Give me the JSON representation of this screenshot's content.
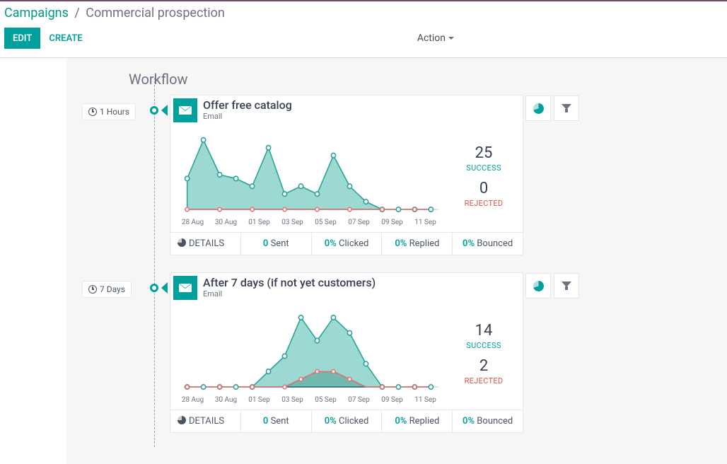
{
  "breadcrumb": {
    "root": "Campaigns",
    "current": "Commercial prospection"
  },
  "toolbar": {
    "edit": "EDIT",
    "create": "CREATE",
    "action": "Action"
  },
  "workflow": {
    "title": "Workflow"
  },
  "activities": [
    {
      "delay": "1 Hours",
      "title": "Offer free catalog",
      "type": "Email",
      "success": 25,
      "success_label": "SUCCESS",
      "rejected": 0,
      "rejected_label": "REJECTED"
    },
    {
      "delay": "7 Days",
      "title": "After 7 days (if not yet customers)",
      "type": "Email",
      "success": 14,
      "success_label": "SUCCESS",
      "rejected": 2,
      "rejected_label": "REJECTED"
    }
  ],
  "footer": {
    "details": "DETAILS",
    "sent_val": "0",
    "sent_lbl": " Sent",
    "clicked_val": "0%",
    "clicked_lbl": " Clicked",
    "replied_val": "0%",
    "replied_lbl": " Replied",
    "bounced_val": "0%",
    "bounced_lbl": " Bounced"
  },
  "chart_data": [
    {
      "type": "area",
      "categories": [
        "28 Aug",
        "30 Aug",
        "01 Sep",
        "03 Sep",
        "05 Sep",
        "07 Sep",
        "09 Sep",
        "11 Sep"
      ],
      "series": [
        {
          "name": "Success",
          "values": [
            4,
            9,
            5,
            4,
            3,
            8,
            2,
            3,
            2,
            7,
            3,
            1,
            0,
            0,
            0,
            0
          ]
        },
        {
          "name": "Rejected",
          "values": [
            0,
            0,
            0,
            0,
            0,
            0,
            0,
            0,
            0,
            0,
            0,
            0,
            0,
            0,
            0,
            0
          ]
        }
      ],
      "ylim": [
        0,
        10
      ]
    },
    {
      "type": "area",
      "categories": [
        "28 Aug",
        "30 Aug",
        "01 Sep",
        "03 Sep",
        "05 Sep",
        "07 Sep",
        "09 Sep",
        "11 Sep"
      ],
      "series": [
        {
          "name": "Success",
          "values": [
            0,
            0,
            0,
            0,
            0,
            2,
            4,
            9,
            6,
            9,
            7,
            3,
            0,
            0,
            0,
            0
          ]
        },
        {
          "name": "Rejected",
          "values": [
            0,
            0,
            0,
            0,
            0,
            0,
            0,
            1,
            2,
            2,
            1,
            0,
            0,
            0,
            0,
            0
          ]
        }
      ],
      "ylim": [
        0,
        10
      ]
    }
  ]
}
